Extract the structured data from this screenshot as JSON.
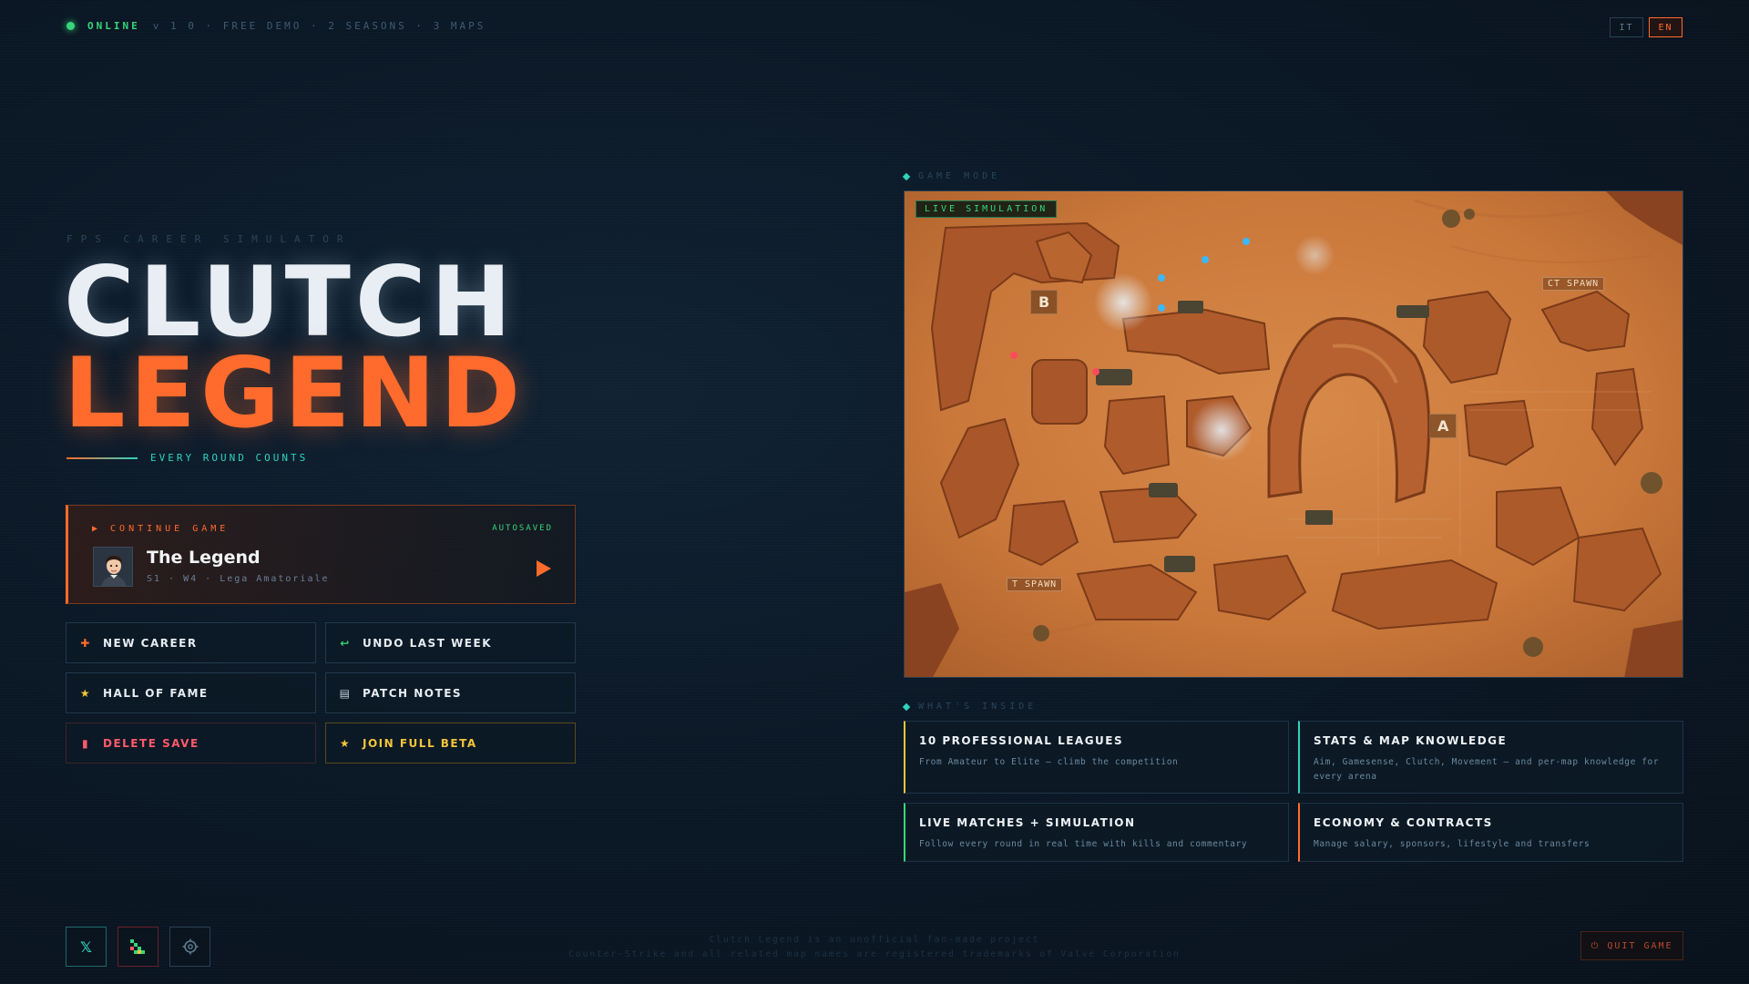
{
  "topbar": {
    "status": "ONLINE",
    "meta": "v 1 0 · FREE DEMO · 2 SEASONS · 3 MAPS",
    "languages": [
      {
        "code": "IT",
        "active": false
      },
      {
        "code": "EN",
        "active": true
      }
    ]
  },
  "hero": {
    "subtitle": "FPS CAREER SIMULATOR",
    "title_line1": "CLUTCH",
    "title_line2": "LEGEND",
    "tagline": "EVERY ROUND COUNTS"
  },
  "continue_card": {
    "label": "▶ CONTINUE GAME",
    "autosaved": "AUTOSAVED",
    "player_name": "The Legend",
    "player_info": "S1 · W4 · Lega Amatoriale"
  },
  "menu": {
    "new_career": "NEW CAREER",
    "undo_last_week": "UNDO LAST WEEK",
    "hall_of_fame": "HALL OF FAME",
    "patch_notes": "PATCH NOTES",
    "delete_save": "DELETE SAVE",
    "join_full_beta": "JOIN FULL BETA"
  },
  "game_mode": {
    "section_label": "GAME MODE",
    "live_tag": "LIVE SIMULATION",
    "site_a": "A",
    "site_b": "B",
    "ct_spawn": "CT SPAWN",
    "t_spawn": "T SPAWN"
  },
  "whats_inside": {
    "section_label": "WHAT'S INSIDE",
    "features": [
      {
        "title": "10 PROFESSIONAL LEAGUES",
        "desc": "From Amateur to Elite — climb the competition"
      },
      {
        "title": "STATS & MAP KNOWLEDGE",
        "desc": "Aim, Gamesense, Clutch, Movement — and per-map knowledge for every arena"
      },
      {
        "title": "LIVE MATCHES + SIMULATION",
        "desc": "Follow every round in real time with kills and commentary"
      },
      {
        "title": "ECONOMY & CONTRACTS",
        "desc": "Manage salary, sponsors, lifestyle and transfers"
      }
    ]
  },
  "footer": {
    "disclaimer_line1": "Clutch Legend is an unofficial fan-made project",
    "disclaimer_line2": "Counter-Strike and all related map names are registered trademarks of Valve Corporation",
    "quit": "⏻ QUIT GAME"
  },
  "colors": {
    "accent": "#ff6b2c",
    "online": "#37d67a",
    "teal": "#2dd4bf",
    "gold": "#f4c53a",
    "danger": "#ff5a6a"
  },
  "icons": {
    "new_career": "plus-icon",
    "undo": "undo-arrow-icon",
    "hall_of_fame": "star-icon",
    "patch_notes": "document-icon",
    "delete_save": "trash-icon",
    "join_beta": "star-icon",
    "social_1": "x-logo-icon",
    "social_2": "bug-icon",
    "social_3": "settings-gear-icon"
  }
}
